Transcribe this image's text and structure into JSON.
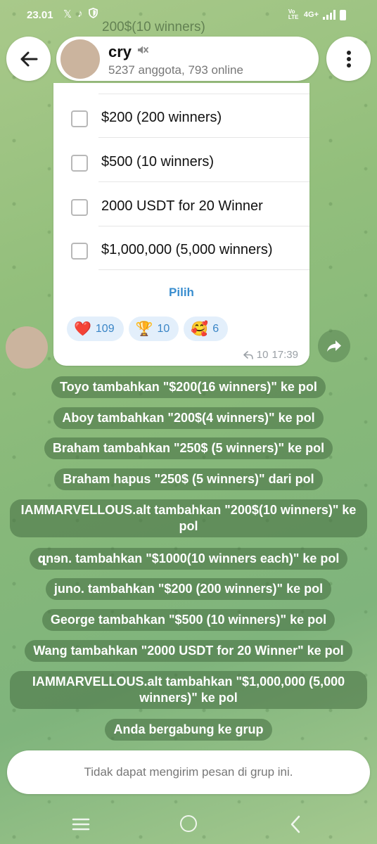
{
  "status_bar": {
    "time": "23.01",
    "left_icons": [
      "x-icon",
      "tiktok-icon",
      "shield-icon"
    ],
    "network": "4G+",
    "volte": "Vo LTE"
  },
  "header": {
    "ghost_title": "200$(10 winners)",
    "group_name": "cry",
    "group_sub": "5237 anggota, 793 online"
  },
  "poll": {
    "options": [
      {
        "label": "$200 (200 winners)"
      },
      {
        "label": "$500 (10 winners)"
      },
      {
        "label": "2000 USDT for 20 Winner"
      },
      {
        "label": "$1,000,000 (5,000 winners)"
      }
    ],
    "submit_label": "Pilih",
    "reactions": [
      {
        "emoji": "❤️",
        "count": "109"
      },
      {
        "emoji": "🏆",
        "count": "10"
      },
      {
        "emoji": "🥰",
        "count": "6"
      }
    ],
    "forwards": "10",
    "time": "17:39"
  },
  "service_messages": [
    "Toyo tambahkan \"$200(16 winners)\" ke pol",
    "Aboy tambahkan \"200$(4 winners)\" ke pol",
    "Braham tambahkan \"250$ (5 winners)\" ke pol",
    "Braham hapus \"250$ (5 winners)\" dari pol",
    "IAMMARVELLOUS.alt tambahkan \"200$(10 winners)\" ke pol",
    " զnɘn. tambahkan \"$1000(10 winners each)\" ke pol",
    "juno. tambahkan \"$200 (200 winners)\" ke pol",
    "George tambahkan \"$500 (10 winners)\" ke pol",
    "Wang tambahkan \"2000 USDT for 20 Winner\" ke pol",
    "IAMMARVELLOUS.alt tambahkan \"$1,000,000 (5,000 winners)\" ke pol",
    "Anda bergabung ke grup"
  ],
  "input_bar": {
    "text": "Tidak dapat mengirim pesan di grup ini."
  },
  "colors": {
    "accent": "#3a8ecf",
    "reaction_bg": "#e3effb",
    "service_bg": "#466e41"
  }
}
